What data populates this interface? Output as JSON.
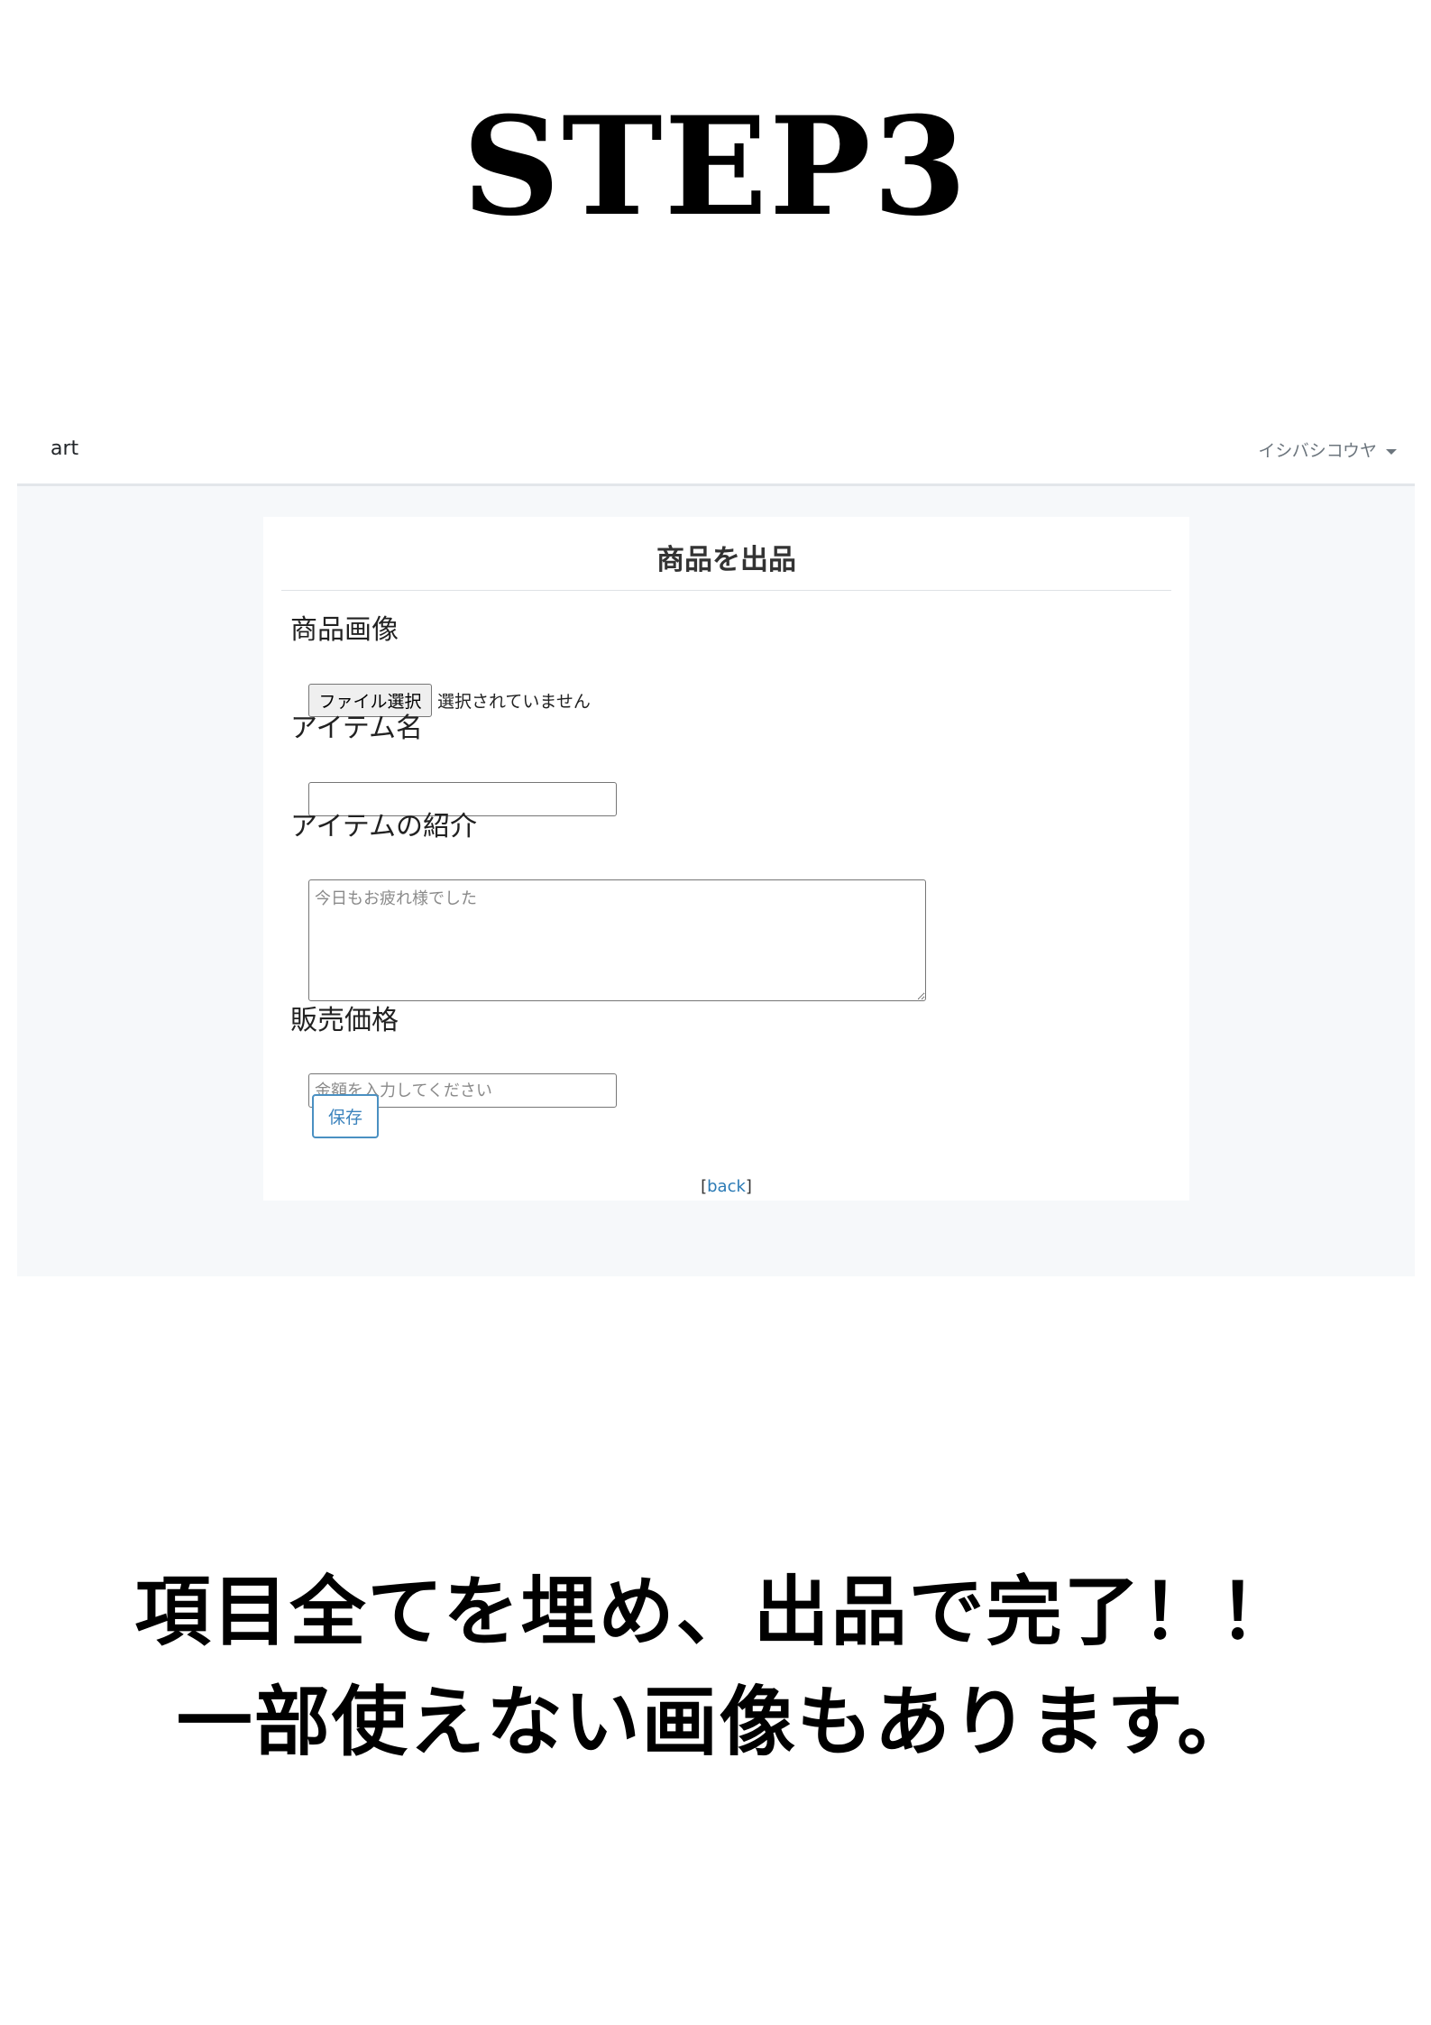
{
  "step_title": "STEP3",
  "navbar": {
    "brand": "art",
    "user": "イシバシコウヤ"
  },
  "form": {
    "title": "商品を出品",
    "image_label": "商品画像",
    "file_button": "ファイル選択",
    "file_status": "選択されていません",
    "name_label": "アイテム名",
    "name_value": "",
    "desc_label": "アイテムの紹介",
    "desc_placeholder": "今日もお疲れ様でした",
    "price_label": "販売価格",
    "price_placeholder": "金額を入力してください",
    "save": "保存",
    "back_open": "[",
    "back": "back",
    "back_close": "]"
  },
  "caption": {
    "line1": "項目全てを埋め、出品で完了！！",
    "line2": "一部使えない画像もあります。"
  }
}
